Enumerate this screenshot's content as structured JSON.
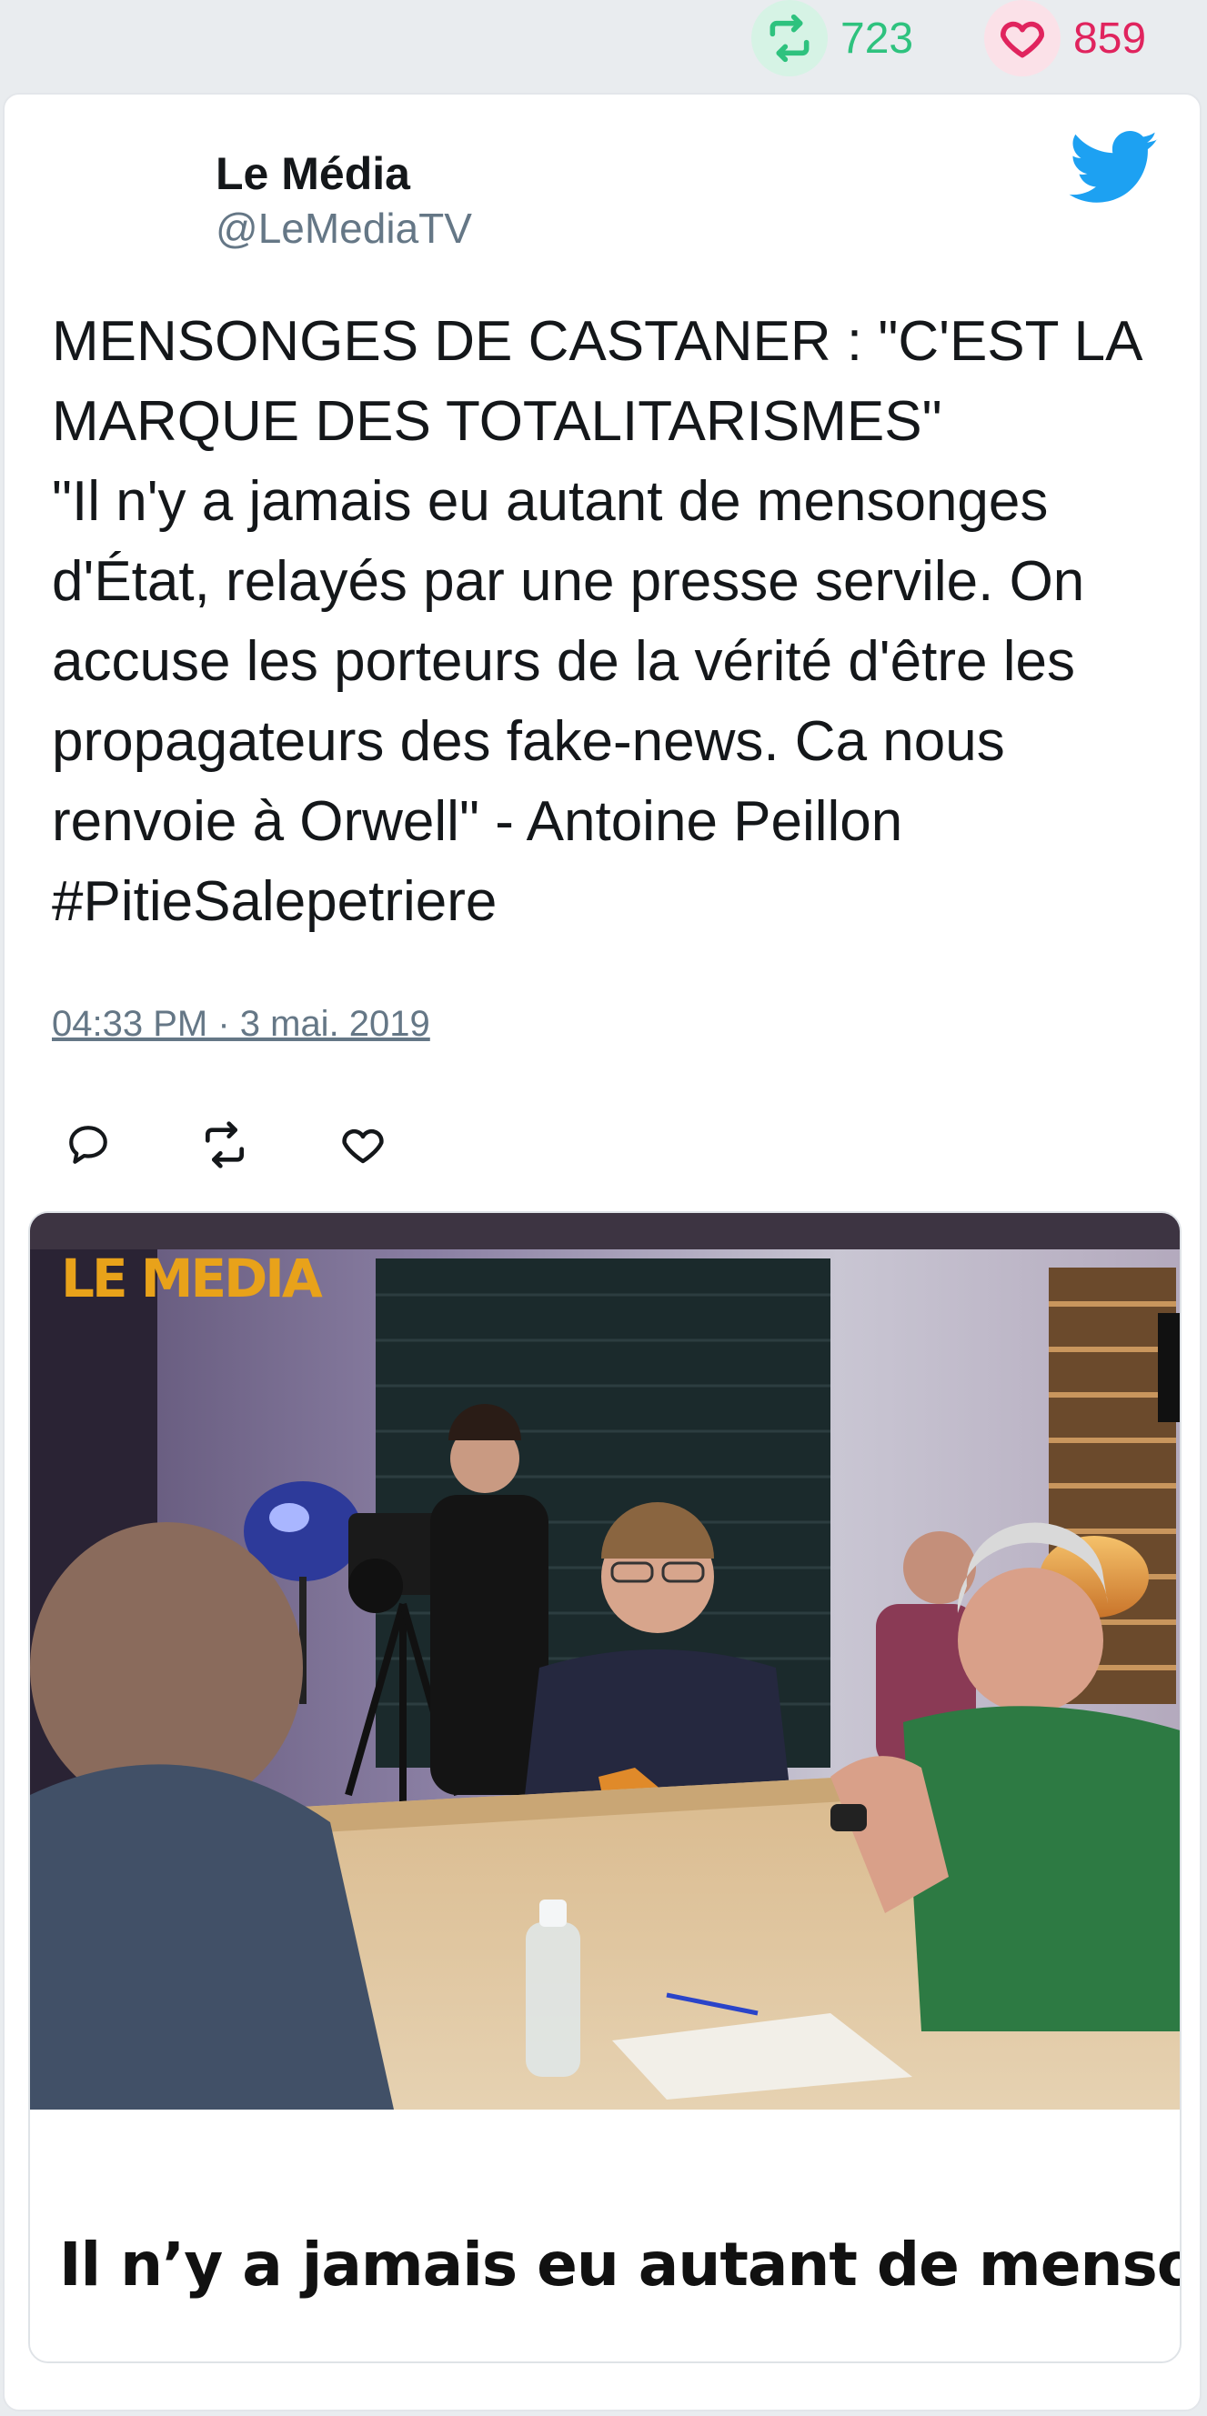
{
  "stats": {
    "retweets": "723",
    "likes": "859",
    "retweet_color": "#2ec27e",
    "like_color": "#e0245e"
  },
  "tweet": {
    "author_name": "Le Média",
    "author_handle": "@LeMediaTV",
    "text": "MENSONGES DE CASTANER : \"C'EST LA MARQUE DES TOTALITARISMES\"\n\"Il n'y a jamais eu autant de mensonges d'État, relayés par une presse servile. On accuse les porteurs de la vérité d'être les propagateurs des fake-news. Ca nous renvoie à Orwell\" - Antoine Peillon #PitieSalepetriere",
    "timestamp": "04:33 PM · 3 mai. 2019"
  },
  "icons": {
    "brand": "twitter-bird-icon",
    "actions": [
      "reply-icon",
      "retweet-icon",
      "like-icon"
    ]
  },
  "media": {
    "logo_text": "LE MEDIA",
    "caption": "Il n’y a jamais eu autant de mensonges,"
  }
}
